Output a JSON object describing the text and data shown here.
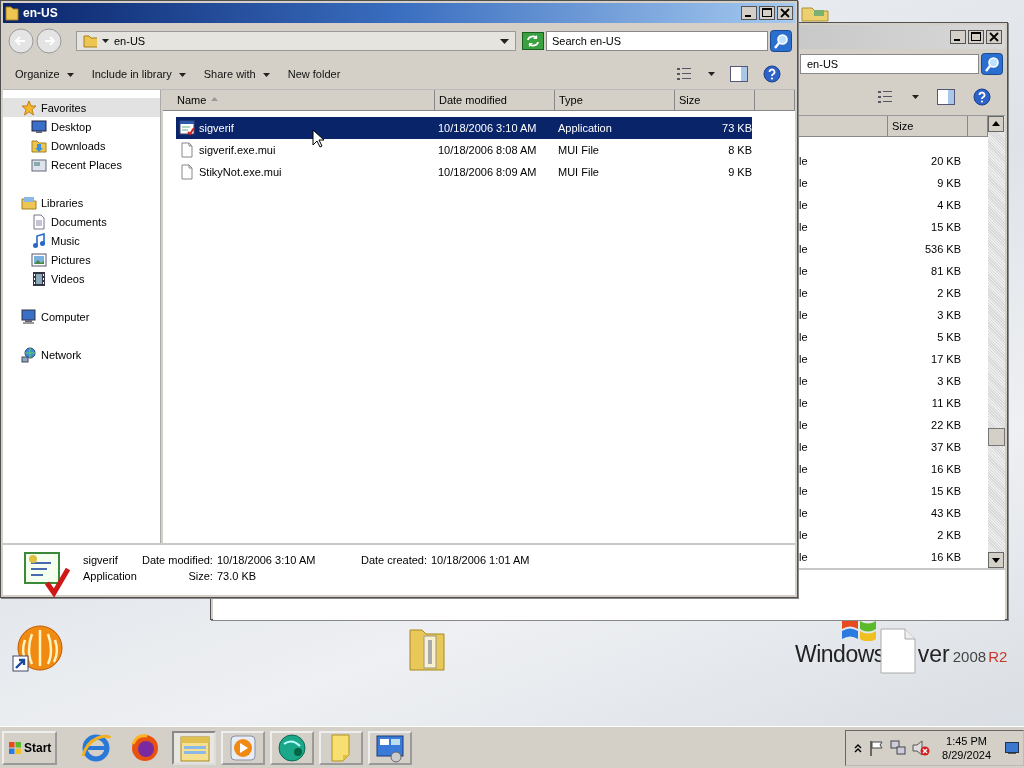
{
  "front_window": {
    "title": "en-US",
    "address": "en-US",
    "search": {
      "placeholder": "Search en-US"
    },
    "toolbar": [
      {
        "label": "Organize",
        "has_menu": true
      },
      {
        "label": "Include in library",
        "has_menu": true
      },
      {
        "label": "Share with",
        "has_menu": true
      },
      {
        "label": "New folder",
        "has_menu": false
      }
    ],
    "navigation": [
      {
        "label": "Favorites",
        "kind": "favorites",
        "selected": true,
        "children": [
          {
            "label": "Desktop",
            "kind": "desktop",
            "selected": false
          },
          {
            "label": "Downloads",
            "kind": "downloads",
            "selected": false
          },
          {
            "label": "Recent Places",
            "kind": "recent",
            "selected": false
          }
        ]
      },
      {
        "label": "Libraries",
        "kind": "libraries",
        "selected": false,
        "children": [
          {
            "label": "Documents",
            "kind": "documents",
            "selected": false
          },
          {
            "label": "Music",
            "kind": "music",
            "selected": false
          },
          {
            "label": "Pictures",
            "kind": "pictures",
            "selected": false
          },
          {
            "label": "Videos",
            "kind": "videos",
            "selected": false
          }
        ]
      },
      {
        "label": "Computer",
        "kind": "computer",
        "selected": false
      },
      {
        "label": "Network",
        "kind": "network",
        "selected": false
      }
    ],
    "columns": [
      {
        "label": "Name",
        "sorted": true
      },
      {
        "label": "Date modified",
        "sorted": false
      },
      {
        "label": "Type",
        "sorted": false
      },
      {
        "label": "Size",
        "sorted": false
      }
    ],
    "files": [
      {
        "name": "sigverif",
        "date_modified": "10/18/2006 3:10 AM",
        "type": "Application",
        "size": "73 KB",
        "kind": "application",
        "selected": true
      },
      {
        "name": "sigverif.exe.mui",
        "date_modified": "10/18/2006 8:08 AM",
        "type": "MUI File",
        "size": "8 KB",
        "kind": "document",
        "selected": false
      },
      {
        "name": "StikyNot.exe.mui",
        "date_modified": "10/18/2006 8:09 AM",
        "type": "MUI File",
        "size": "9 KB",
        "kind": "document",
        "selected": false
      }
    ],
    "details": {
      "name": "sigverif",
      "type": "Application",
      "fields": [
        {
          "label": "Date modified:",
          "value": "10/18/2006 3:10 AM"
        },
        {
          "label": "Date created:",
          "value": "10/18/2006 1:01 AM"
        },
        {
          "label": "Size:",
          "value": "73.0 KB"
        }
      ]
    }
  },
  "back_window": {
    "search_text": "en-US",
    "columns": [
      {
        "label": "Size"
      }
    ],
    "rows": [
      {
        "column_1": "le",
        "size": "20 KB"
      },
      {
        "column_1": "le",
        "size": "9 KB"
      },
      {
        "column_1": "le",
        "size": "4 KB"
      },
      {
        "column_1": "le",
        "size": "15 KB"
      },
      {
        "column_1": "le",
        "size": "536 KB"
      },
      {
        "column_1": "le",
        "size": "81 KB"
      },
      {
        "column_1": "le",
        "size": "2 KB"
      },
      {
        "column_1": "le",
        "size": "3 KB"
      },
      {
        "column_1": "le",
        "size": "5 KB"
      },
      {
        "column_1": "le",
        "size": "17 KB"
      },
      {
        "column_1": "le",
        "size": "3 KB"
      },
      {
        "column_1": "le",
        "size": "11 KB"
      },
      {
        "column_1": "le",
        "size": "22 KB"
      },
      {
        "column_1": "le",
        "size": "37 KB"
      },
      {
        "column_1": "le",
        "size": "16 KB"
      },
      {
        "column_1": "le",
        "size": "15 KB"
      },
      {
        "column_1": "le",
        "size": "43 KB"
      },
      {
        "column_1": "le",
        "size": "2 KB"
      },
      {
        "column_1": "le",
        "size": "16 KB"
      }
    ]
  },
  "desktop": {
    "logo": {
      "brand": "Windows",
      "suffix": "ver",
      "version": "2008",
      "edition": "R2"
    }
  },
  "taskbar": {
    "start": "Start",
    "buttons": [
      {
        "kind": "browser",
        "running": false,
        "pressed": false
      },
      {
        "kind": "fox",
        "running": false,
        "pressed": false
      },
      {
        "kind": "explorer",
        "running": true,
        "pressed": true
      },
      {
        "kind": "media",
        "running": true,
        "pressed": false
      },
      {
        "kind": "disc",
        "running": true,
        "pressed": false
      },
      {
        "kind": "note",
        "running": true,
        "pressed": false
      },
      {
        "kind": "server",
        "running": true,
        "pressed": false
      }
    ],
    "clock": {
      "time": "1:45 PM",
      "date": "8/29/2024"
    }
  }
}
